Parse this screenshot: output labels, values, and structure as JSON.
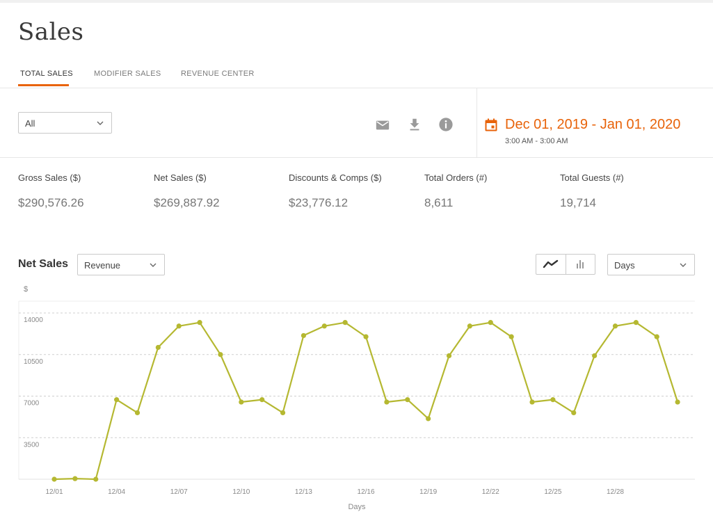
{
  "page": {
    "title": "Sales"
  },
  "tabs": [
    {
      "label": "TOTAL SALES",
      "active": true
    },
    {
      "label": "MODIFIER SALES",
      "active": false
    },
    {
      "label": "REVENUE CENTER",
      "active": false
    }
  ],
  "toolbar": {
    "filter_value": "All",
    "icons": [
      "email-icon",
      "download-icon",
      "info-icon"
    ]
  },
  "date_range": {
    "icon": "calendar-icon",
    "label": "Dec 01, 2019 - Jan 01, 2020",
    "time": "3:00 AM - 3:00 AM",
    "color": "#e8630a"
  },
  "metrics": [
    {
      "label": "Gross Sales ($)",
      "value": "$290,576.26"
    },
    {
      "label": "Net Sales ($)",
      "value": "$269,887.92"
    },
    {
      "label": "Discounts & Comps ($)",
      "value": "$23,776.12"
    },
    {
      "label": "Total Orders (#)",
      "value": "8,611"
    },
    {
      "label": "Total Guests (#)",
      "value": "19,714"
    }
  ],
  "chart_section": {
    "title": "Net Sales",
    "measure_value": "Revenue",
    "interval_value": "Days",
    "view_toggle_icons": [
      "line-chart-icon",
      "bar-chart-icon"
    ],
    "active_view": "line"
  },
  "chart_data": {
    "type": "line",
    "title": "",
    "ylabel": "$",
    "xlabel": "Days",
    "ylim": [
      0,
      14000
    ],
    "yticks": [
      3500,
      7000,
      10500,
      14000
    ],
    "grid": true,
    "line_color": "#b5b831",
    "x": [
      "12/01",
      "12/02",
      "12/03",
      "12/04",
      "12/05",
      "12/06",
      "12/07",
      "12/08",
      "12/09",
      "12/10",
      "12/11",
      "12/12",
      "12/13",
      "12/14",
      "12/15",
      "12/16",
      "12/17",
      "12/18",
      "12/19",
      "12/20",
      "12/21",
      "12/22",
      "12/23",
      "12/24",
      "12/25",
      "12/26",
      "12/27",
      "12/28",
      "12/29",
      "12/30",
      "12/31"
    ],
    "xticks": [
      "12/01",
      "12/04",
      "12/07",
      "12/10",
      "12/13",
      "12/16",
      "12/19",
      "12/22",
      "12/25",
      "12/28"
    ],
    "series": [
      {
        "name": "",
        "values": [
          0,
          50,
          0,
          6700,
          5600,
          11100,
          12900,
          13200,
          10500,
          6500,
          6700,
          5600,
          12100,
          12900,
          13200,
          12000,
          6500,
          6700,
          5100,
          10400,
          12900,
          13200,
          12000,
          6500,
          6700,
          5600,
          10400,
          12900,
          13200,
          12000,
          6500
        ]
      }
    ]
  }
}
